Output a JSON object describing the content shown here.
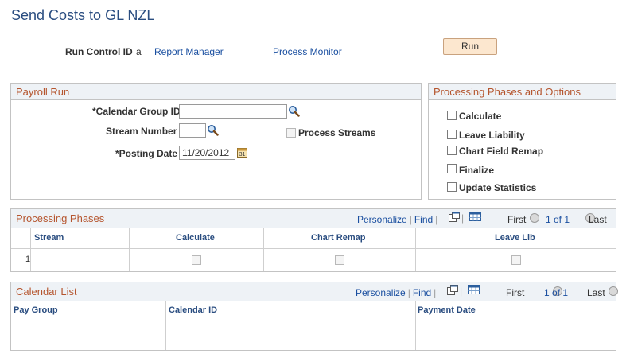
{
  "page": {
    "title": "Send Costs to GL NZL"
  },
  "run_control": {
    "label": "Run Control ID",
    "value": "a",
    "report_manager": "Report Manager",
    "process_monitor": "Process Monitor",
    "run_button": "Run"
  },
  "payroll_run": {
    "header": "Payroll Run",
    "calendar_group_label": "*Calendar Group ID",
    "calendar_group_value": "",
    "stream_number_label": "Stream Number",
    "stream_number_value": "",
    "process_streams_label": "Process Streams",
    "posting_date_label": "*Posting Date",
    "posting_date_value": "11/20/2012"
  },
  "options": {
    "header": "Processing Phases and Options",
    "items": [
      {
        "label": "Calculate",
        "checked": false
      },
      {
        "label": "Leave Liability",
        "checked": false
      },
      {
        "label": "Chart Field Remap",
        "checked": false
      },
      {
        "label": "Finalize",
        "checked": false
      },
      {
        "label": "Update Statistics",
        "checked": false
      }
    ]
  },
  "processing_phases": {
    "header": "Processing Phases",
    "toolbar": {
      "personalize": "Personalize",
      "find": "Find",
      "first": "First",
      "range": "1 of 1",
      "last": "Last"
    },
    "columns": [
      "Stream",
      "Calculate",
      "Chart Remap",
      "Leave Lib"
    ],
    "rows": [
      {
        "row_num": "1"
      }
    ]
  },
  "calendar_list": {
    "header": "Calendar List",
    "toolbar": {
      "personalize": "Personalize",
      "find": "Find",
      "first": "First",
      "range": "1 of 1",
      "last": "Last"
    },
    "columns": [
      "Pay Group",
      "Calendar ID",
      "Payment Date"
    ]
  },
  "colors": {
    "title": "#2a4d80",
    "section_header": "#b5552e",
    "link": "#1a4fa0",
    "run_button_bg": "#fce7cf"
  }
}
